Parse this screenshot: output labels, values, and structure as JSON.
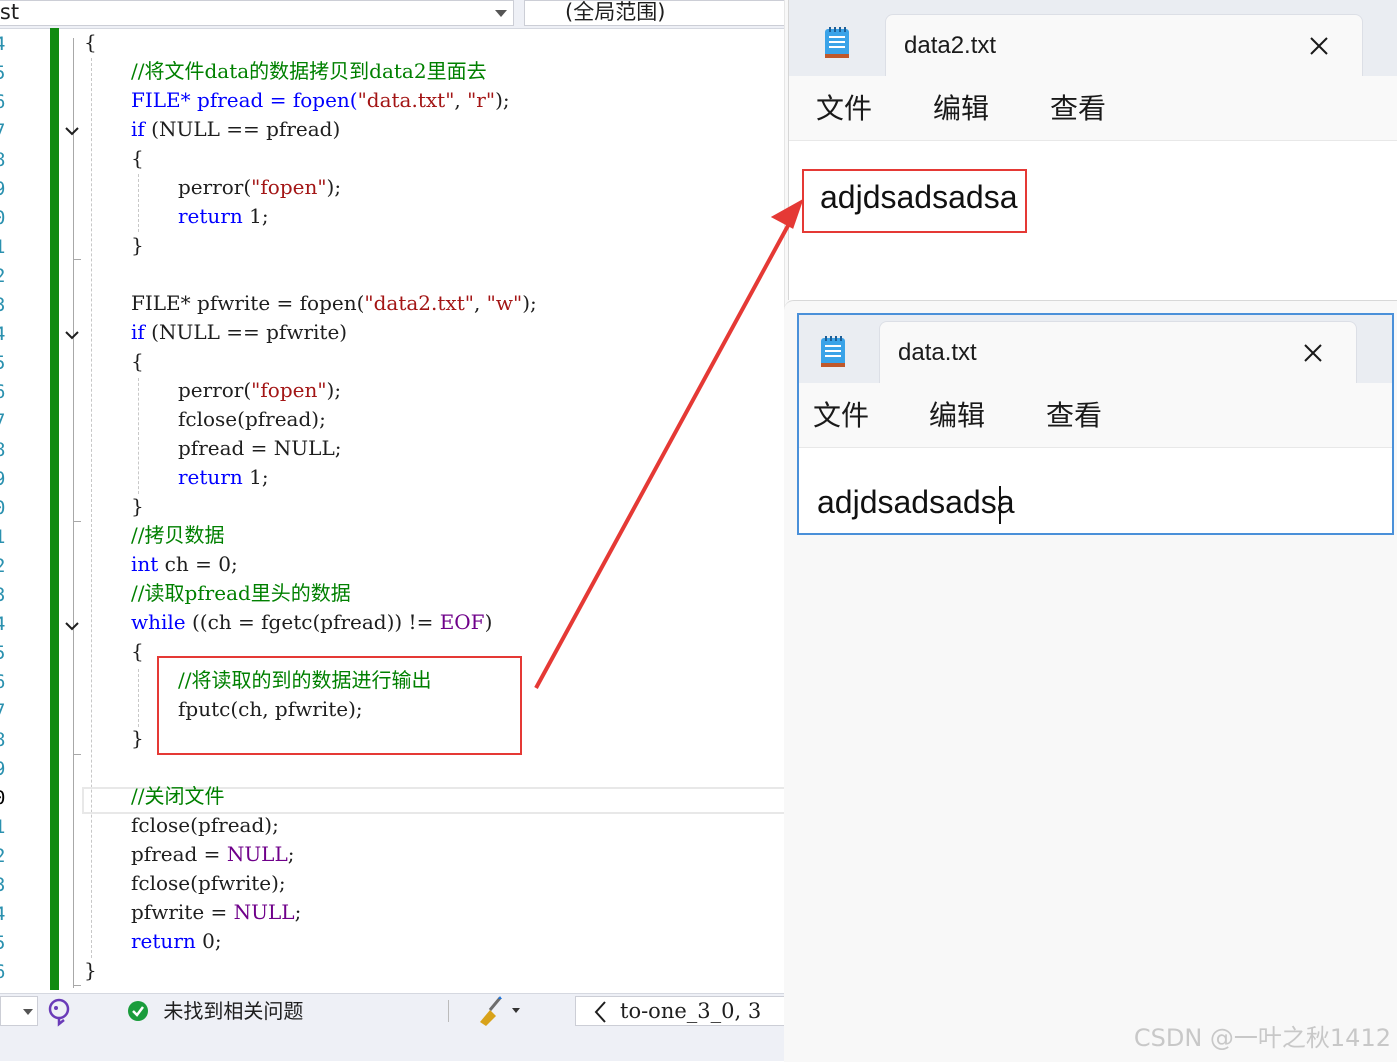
{
  "ide": {
    "project_combo": "est",
    "scope_combo": "(全局范围)",
    "line_numbers": [
      "4",
      "5",
      "6",
      "7",
      "8",
      "9",
      "0",
      "1",
      "2",
      "3",
      "4",
      "5",
      "6",
      "7",
      "8",
      "9",
      "0",
      "1",
      "2",
      "3",
      "4",
      "5",
      "6",
      "7",
      "8",
      "9",
      "0",
      "1",
      "2",
      "3",
      "4",
      "5",
      "6"
    ],
    "current_line_index": 26,
    "code": {
      "l0": "{",
      "l1_comment": "//将文件data的数据拷贝到data2里面去",
      "l2_a": "FILE* pfread = fopen(",
      "l2_str1": "\"data.txt\"",
      "l2_b": ", ",
      "l2_str2": "\"r\"",
      "l2_c": ");",
      "l3_kw": "if",
      "l3_rest": " (NULL == pfread)",
      "l4": "{",
      "l5_a": "perror(",
      "l5_str": "\"fopen\"",
      "l5_b": ");",
      "l6_kw": "return",
      "l6_rest": " 1;",
      "l7": "}",
      "l9_a": "FILE* pfwrite = fopen(",
      "l9_str1": "\"data2.txt\"",
      "l9_b": ", ",
      "l9_str2": "\"w\"",
      "l9_c": ");",
      "l10_kw": "if",
      "l10_rest": " (NULL == pfwrite)",
      "l11": "{",
      "l12_a": "perror(",
      "l12_str": "\"fopen\"",
      "l12_b": ");",
      "l13": "fclose(pfread);",
      "l14": "pfread = NULL;",
      "l15_kw": "return",
      "l15_rest": " 1;",
      "l16": "}",
      "l17_comment": "//拷贝数据",
      "l18_kw": "int",
      "l18_rest": " ch = 0;",
      "l19_comment": "//读取pfread里头的数据",
      "l20_kw": "while",
      "l20_a": " ((ch = fgetc(pfread)) != ",
      "l20_mac": "EOF",
      "l20_b": ")",
      "l21": "{",
      "l22_comment": "//将读取的到的数据进行输出",
      "l23": "fputc(ch, pfwrite);",
      "l24": "}",
      "l26_comment": "//关闭文件",
      "l27": "fclose(pfread);",
      "l28_a": "pfread = ",
      "l28_mac": "NULL",
      "l28_b": ";",
      "l29": "fclose(pfwrite);",
      "l30_a": "pfwrite = ",
      "l30_mac": "NULL",
      "l30_b": ";",
      "l31_kw": "return",
      "l31_rest": " 0;",
      "l32": "}"
    },
    "statusbar": {
      "issues_text": "未找到相关问题",
      "nav_text": "to-one_3_0, 3"
    }
  },
  "notepad_top": {
    "tab_title": "data2.txt",
    "menu": [
      "文件",
      "编辑",
      "查看"
    ],
    "content": "adjdsadsadsa"
  },
  "notepad_bottom": {
    "tab_title": "data.txt",
    "menu": [
      "文件",
      "编辑",
      "查看"
    ],
    "content": "adjdsadsadsa"
  },
  "watermark": "CSDN @一叶之秋1412",
  "colors": {
    "annotation_red": "#e53935",
    "change_bar_green": "#108a10",
    "keyword_blue": "#0000ff",
    "comment_green": "#008000",
    "string_red": "#a31515",
    "macro_purple": "#6f008a"
  },
  "icons": [
    "chevron-down-icon",
    "check-circle-icon",
    "ai-assistant-icon",
    "cleanup-brush-icon",
    "notepad-app-icon",
    "close-icon",
    "chevron-left-icon"
  ]
}
